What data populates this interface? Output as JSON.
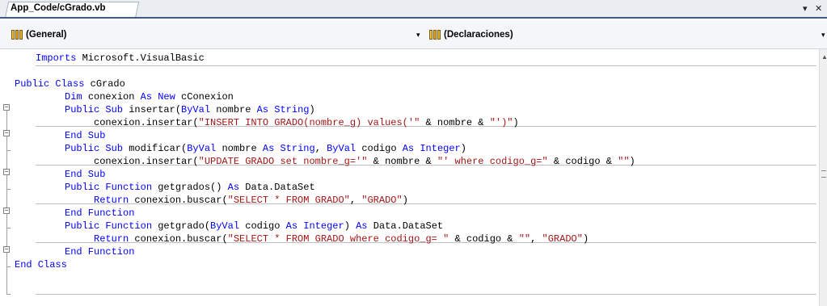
{
  "tab": {
    "title": "App_Code/cGrado.vb"
  },
  "window_controls": {
    "dropdown": "▾",
    "close": "✕"
  },
  "navbar": {
    "left": {
      "value": "(General)"
    },
    "right": {
      "value": "(Declaraciones)"
    },
    "dropdown_glyph": "▾"
  },
  "editor": {
    "lines": [
      [
        {
          "t": "Imports Microsoft.VisualBasic",
          "c": "kw-first"
        }
      ],
      [],
      [
        {
          "t": "Public Class ",
          "c": "kw"
        },
        {
          "t": "cGrado",
          "c": ""
        }
      ],
      [
        {
          "t": "Dim ",
          "c": "kw"
        },
        {
          "t": "conexion ",
          "c": ""
        },
        {
          "t": "As New ",
          "c": "kw"
        },
        {
          "t": "cConexion",
          "c": ""
        }
      ],
      [
        {
          "t": "Public Sub ",
          "c": "kw"
        },
        {
          "t": "insertar(",
          "c": ""
        },
        {
          "t": "ByVal ",
          "c": "kw"
        },
        {
          "t": "nombre ",
          "c": ""
        },
        {
          "t": "As String",
          "c": "kw"
        },
        {
          "t": ")",
          "c": ""
        }
      ],
      [
        {
          "t": "conexion.insertar(",
          "c": ""
        },
        {
          "t": "\"INSERT INTO GRADO(nombre_g) values('\"",
          "c": "str"
        },
        {
          "t": " & nombre & ",
          "c": ""
        },
        {
          "t": "\"')\"",
          "c": "str"
        },
        {
          "t": ")",
          "c": ""
        }
      ],
      [
        {
          "t": "End Sub",
          "c": "kw"
        }
      ],
      [
        {
          "t": "Public Sub ",
          "c": "kw"
        },
        {
          "t": "modificar(",
          "c": ""
        },
        {
          "t": "ByVal ",
          "c": "kw"
        },
        {
          "t": "nombre ",
          "c": ""
        },
        {
          "t": "As String",
          "c": "kw"
        },
        {
          "t": ", ",
          "c": ""
        },
        {
          "t": "ByVal ",
          "c": "kw"
        },
        {
          "t": "codigo ",
          "c": ""
        },
        {
          "t": "As Integer",
          "c": "kw"
        },
        {
          "t": ")",
          "c": ""
        }
      ],
      [
        {
          "t": "conexion.insertar(",
          "c": ""
        },
        {
          "t": "\"UPDATE GRADO set nombre_g='\"",
          "c": "str"
        },
        {
          "t": " & nombre & ",
          "c": ""
        },
        {
          "t": "\"' where codigo_g=\"",
          "c": "str"
        },
        {
          "t": " & codigo & ",
          "c": ""
        },
        {
          "t": "\"\"",
          "c": "str"
        },
        {
          "t": ")",
          "c": ""
        }
      ],
      [
        {
          "t": "End Sub",
          "c": "kw"
        }
      ],
      [
        {
          "t": "Public Function ",
          "c": "kw"
        },
        {
          "t": "getgrados() ",
          "c": ""
        },
        {
          "t": "As ",
          "c": "kw"
        },
        {
          "t": "Data.DataSet",
          "c": ""
        }
      ],
      [
        {
          "t": "Return ",
          "c": "kw"
        },
        {
          "t": "conexion.buscar(",
          "c": ""
        },
        {
          "t": "\"SELECT * FROM GRADO\"",
          "c": "str"
        },
        {
          "t": ", ",
          "c": ""
        },
        {
          "t": "\"GRADO\"",
          "c": "str"
        },
        {
          "t": ")",
          "c": ""
        }
      ],
      [
        {
          "t": "End Function",
          "c": "kw"
        }
      ],
      [
        {
          "t": "Public Function ",
          "c": "kw"
        },
        {
          "t": "getgrado(",
          "c": ""
        },
        {
          "t": "ByVal ",
          "c": "kw"
        },
        {
          "t": "codigo ",
          "c": ""
        },
        {
          "t": "As Integer",
          "c": "kw"
        },
        {
          "t": ") ",
          "c": ""
        },
        {
          "t": "As ",
          "c": "kw"
        },
        {
          "t": "Data.DataSet",
          "c": ""
        }
      ],
      [
        {
          "t": "Return ",
          "c": "kw"
        },
        {
          "t": "conexion.buscar(",
          "c": ""
        },
        {
          "t": "\"SELECT * FROM GRADO where codigo_g= \"",
          "c": "str"
        },
        {
          "t": " & codigo & ",
          "c": ""
        },
        {
          "t": "\"\"",
          "c": "str"
        },
        {
          "t": ", ",
          "c": ""
        },
        {
          "t": "\"GRADO\"",
          "c": "str"
        },
        {
          "t": ")",
          "c": ""
        }
      ],
      [
        {
          "t": "End Function",
          "c": "kw"
        }
      ],
      [
        {
          "t": "End Class",
          "c": "kw"
        }
      ]
    ]
  },
  "colors": {
    "keyword": "#0000ff",
    "string": "#a31515",
    "text": "#000000"
  }
}
